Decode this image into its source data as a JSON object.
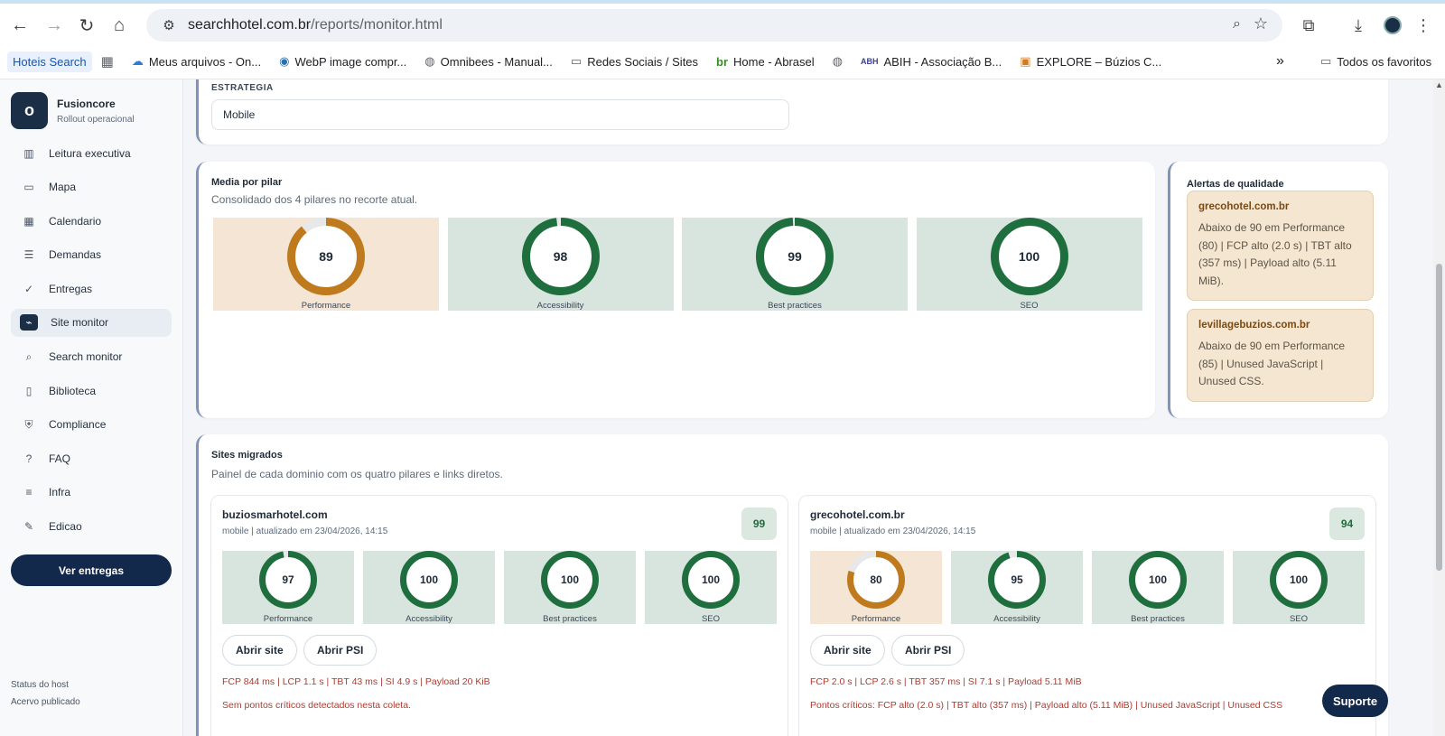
{
  "browser": {
    "url_host": "searchhotel.com.br",
    "url_path": "/reports/monitor.html",
    "bookmarks": [
      {
        "label": "Hoteis Search",
        "icon": "none"
      },
      {
        "label": "",
        "icon": "apps-grid-icon"
      },
      {
        "label": "Meus arquivos - On...",
        "icon": "cloud-icon"
      },
      {
        "label": "WebP image compr...",
        "icon": "webp-icon"
      },
      {
        "label": "Omnibees - Manual...",
        "icon": "globe-icon"
      },
      {
        "label": "Redes Sociais / Sites",
        "icon": "folder-icon"
      },
      {
        "label": "Home - Abrasel",
        "icon": "br-icon"
      },
      {
        "label": "",
        "icon": "globe-icon"
      },
      {
        "label": "ABIH - Associação B...",
        "icon": "abih-icon"
      },
      {
        "label": "EXPLORE – Búzios C...",
        "icon": "explore-icon"
      }
    ],
    "more": "»",
    "all_favorites": "Todos os favoritos"
  },
  "sidebar": {
    "brand_name": "Fusioncore",
    "brand_sub": "Rollout operacional",
    "items": [
      {
        "label": "Leitura executiva",
        "icon": "bar-chart-icon",
        "glyph": "▥"
      },
      {
        "label": "Mapa",
        "icon": "map-icon",
        "glyph": "▭"
      },
      {
        "label": "Calendario",
        "icon": "calendar-icon",
        "glyph": "▦"
      },
      {
        "label": "Demandas",
        "icon": "list-icon",
        "glyph": "☰"
      },
      {
        "label": "Entregas",
        "icon": "check-circle-icon",
        "glyph": "✓"
      },
      {
        "label": "Site monitor",
        "icon": "pulse-icon",
        "glyph": "⌁"
      },
      {
        "label": "Search monitor",
        "icon": "search-icon",
        "glyph": "⌕"
      },
      {
        "label": "Biblioteca",
        "icon": "book-icon",
        "glyph": "▯"
      },
      {
        "label": "Compliance",
        "icon": "shield-icon",
        "glyph": "⛨"
      },
      {
        "label": "FAQ",
        "icon": "help-icon",
        "glyph": "?"
      },
      {
        "label": "Infra",
        "icon": "server-icon",
        "glyph": "≡"
      },
      {
        "label": "Edicao",
        "icon": "pencil-icon",
        "glyph": "✎"
      }
    ],
    "active": "Site monitor",
    "cta": "Ver entregas",
    "status_host": "Status do host",
    "acervo": "Acervo publicado"
  },
  "strategy": {
    "label": "ESTRATEGIA",
    "value": "Mobile"
  },
  "pillars": {
    "title": "Media por pilar",
    "subtitle": "Consolidado dos 4 pilares no recorte atual.",
    "items": [
      {
        "label": "Performance",
        "score": 89
      },
      {
        "label": "Accessibility",
        "score": 98
      },
      {
        "label": "Best practices",
        "score": 99
      },
      {
        "label": "SEO",
        "score": 100
      }
    ]
  },
  "alerts": {
    "title": "Alertas de qualidade",
    "items": [
      {
        "domain": "grecohotel.com.br",
        "text": "Abaixo de 90 em Performance (80) | FCP alto (2.0 s) | TBT alto (357 ms) | Payload alto (5.11 MiB)."
      },
      {
        "domain": "levillagebuzios.com.br",
        "text": "Abaixo de 90 em Performance (85) | Unused JavaScript | Unused CSS."
      }
    ]
  },
  "sites": {
    "title": "Sites migrados",
    "subtitle": "Painel de cada dominio com os quatro pilares e links diretos.",
    "open_site": "Abrir site",
    "open_psi": "Abrir PSI",
    "items": [
      {
        "domain": "buziosmarhotel.com",
        "meta": "mobile | atualizado em 23/04/2026, 14:15",
        "score": 99,
        "pillars": [
          {
            "label": "Performance",
            "score": 97
          },
          {
            "label": "Accessibility",
            "score": 100
          },
          {
            "label": "Best practices",
            "score": 100
          },
          {
            "label": "SEO",
            "score": 100
          }
        ],
        "metrics": "FCP 844 ms | LCP 1.1 s | TBT 43 ms | SI 4.9 s | Payload 20 KiB",
        "critical": "Sem pontos críticos detectados nesta coleta."
      },
      {
        "domain": "grecohotel.com.br",
        "meta": "mobile | atualizado em 23/04/2026, 14:15",
        "score": 94,
        "pillars": [
          {
            "label": "Performance",
            "score": 80
          },
          {
            "label": "Accessibility",
            "score": 95
          },
          {
            "label": "Best practices",
            "score": 100
          },
          {
            "label": "SEO",
            "score": 100
          }
        ],
        "metrics": "FCP 2.0 s | LCP 2.6 s | TBT 357 ms | SI 7.1 s | Payload 5.11 MiB",
        "critical": "Pontos críticos: FCP alto (2.0 s) | TBT alto (357 ms) | Payload alto (5.11 MiB) | Unused JavaScript | Unused CSS"
      }
    ]
  },
  "support": "Suporte",
  "colors": {
    "good": "#1f6e3e",
    "warn": "#c07a1e",
    "track": "#e6e8ea",
    "navy": "#13294b"
  }
}
